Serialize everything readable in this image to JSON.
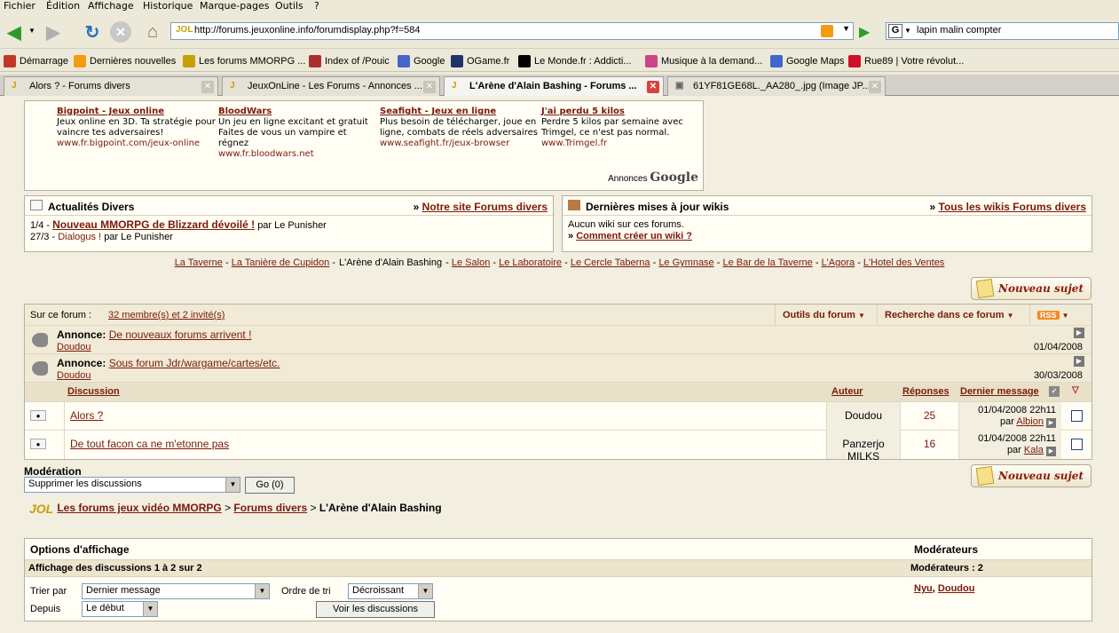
{
  "menu": [
    "Fichier",
    "Édition",
    "Affichage",
    "Historique",
    "Marque-pages",
    "Outils",
    "?"
  ],
  "url": "http://forums.jeuxonline.info/forumdisplay.php?f=584",
  "search_value": "lapin malin compter",
  "bookmarks": [
    {
      "label": "Démarrage",
      "color": "#c0392b"
    },
    {
      "label": "Dernières nouvelles",
      "color": "#f39c12"
    },
    {
      "label": "Les forums MMORPG ...",
      "color": "#c8a000"
    },
    {
      "label": "Index of /Pouic",
      "color": "#a83030"
    },
    {
      "label": "Google",
      "color": "#4466cc"
    },
    {
      "label": "OGame.fr",
      "color": "#223366"
    },
    {
      "label": "Le Monde.fr : Addicti...",
      "color": "#000000"
    },
    {
      "label": "Musique à la demand...",
      "color": "#cc4488"
    },
    {
      "label": "Google Maps",
      "color": "#4466cc"
    },
    {
      "label": "Rue89 | Votre révolut...",
      "color": "#d0102a"
    }
  ],
  "tabs": [
    {
      "label": "Alors ? - Forums divers"
    },
    {
      "label": "JeuxOnLine - Les Forums - Annonces ..."
    },
    {
      "label": "L'Arène d'Alain Bashing - Forums ..."
    },
    {
      "label": "61YF81GE68L._AA280_.jpg (Image JP..."
    }
  ],
  "ads": [
    {
      "title": "Bigpoint - Jeux online",
      "text": "Jeux online en 3D. Ta stratégie pour vaincre tes adversaires!",
      "url": "www.fr.bigpoint.com/jeux-online"
    },
    {
      "title": "BloodWars",
      "text": "Un jeu en ligne excitant et gratuit Faites de vous un vampire et régnez",
      "url": "www.fr.bloodwars.net"
    },
    {
      "title": "Seafight - Jeux en ligne",
      "text": "Plus besoin de télécharger, joue en ligne, combats de réels adversaires",
      "url": "www.seafight.fr/jeux-browser"
    },
    {
      "title": "J'ai perdu 5 kilos",
      "text": "Perdre 5 kilos par semaine avec Trimgel, ce n'est pas normal.",
      "url": "www.Trimgel.fr"
    }
  ],
  "ads_label": "Annonces",
  "ads_brand": "Google",
  "news": {
    "title": "Actualités Divers",
    "link": "Notre site Forums divers",
    "items": [
      {
        "date": "1/4 -",
        "title": "Nouveau MMORPG de Blizzard dévoilé !",
        "by": "par Le Punisher"
      },
      {
        "date": "27/3 -",
        "title": "Dialogus !",
        "by": "par Le Punisher"
      }
    ]
  },
  "wikis": {
    "title": "Dernières mises à jour wikis",
    "link": "Tous les wikis Forums divers",
    "line1": "Aucun wiki sur ces forums.",
    "line2": "Comment créer un wiki ?"
  },
  "forum_nav": [
    "La Taverne",
    "La Tanière de Cupidon",
    "L'Arène d'Alain Bashing",
    "Le Salon",
    "Le Laboratoire",
    "Le Cercle Taberna",
    "Le Gymnase",
    "Le Bar de la Taverne",
    "L'Agora",
    "L'Hotel des Ventes"
  ],
  "new_topic": "Nouveau sujet",
  "on_forum_label": "Sur ce forum :",
  "on_forum_link": "32 membre(s) et 2 invité(s)",
  "tools": {
    "forum": "Outils du forum",
    "search": "Recherche dans ce forum",
    "rss": "RSS"
  },
  "announcements": [
    {
      "label": "Annonce:",
      "title": "De nouveaux forums arrivent !",
      "user": "Doudou",
      "date": "01/04/2008"
    },
    {
      "label": "Annonce:",
      "title": "Sous forum Jdr/wargame/cartes/etc.",
      "user": "Doudou",
      "date": "30/03/2008"
    }
  ],
  "columns": {
    "discussion": "Discussion",
    "author": "Auteur",
    "replies": "Réponses",
    "last": "Dernier message"
  },
  "threads": [
    {
      "title": "Alors ?",
      "author": "Doudou",
      "replies": "25",
      "last_date": "01/04/2008 22h11",
      "last_by_label": "par",
      "last_by": "Albion"
    },
    {
      "title": "De tout facon ca ne m'etonne pas",
      "author": "Panzerjo MILKS",
      "replies": "16",
      "last_date": "01/04/2008 22h11",
      "last_by_label": "par",
      "last_by": "Kala"
    }
  ],
  "moderation": {
    "label": "Modération",
    "select": "Supprimer les discussions",
    "go": "Go (0)"
  },
  "breadcrumb": {
    "root": "Les forums jeux vidéo MMORPG",
    "sep": ">",
    "parent": "Forums divers",
    "current": "L'Arène d'Alain Bashing"
  },
  "options": {
    "title": "Options d'affichage",
    "showing": "Affichage des discussions 1 à 2 sur 2",
    "sort_label": "Trier par",
    "sort_value": "Dernier message",
    "order_label": "Ordre de tri",
    "order_value": "Décroissant",
    "since_label": "Depuis",
    "since_value": "Le début",
    "view_button": "Voir les discussions"
  },
  "moderators": {
    "title": "Modérateurs",
    "count": "Modérateurs : 2",
    "names": [
      "Nyu",
      "Doudou"
    ]
  }
}
